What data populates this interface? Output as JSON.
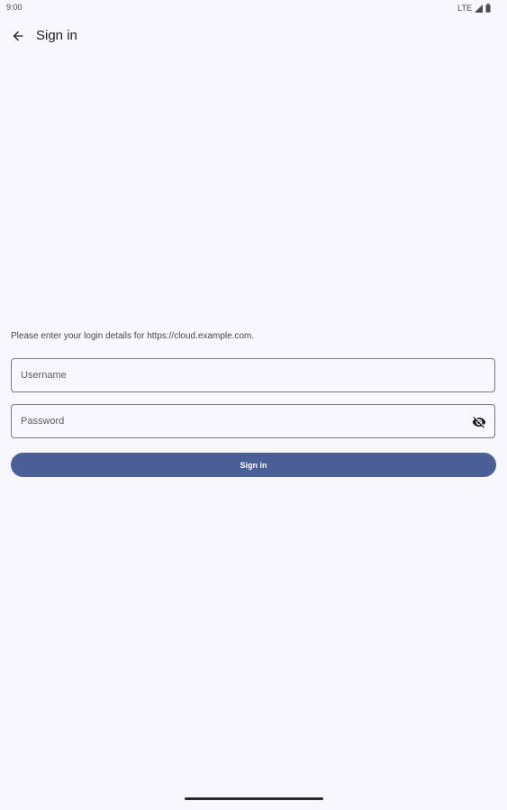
{
  "status_bar": {
    "time": "9:00",
    "network": "LTE",
    "signal_icon": "cell-signal-icon",
    "battery_icon": "battery-icon"
  },
  "app_bar": {
    "back_icon": "arrow-back-icon",
    "title": "Sign in"
  },
  "form": {
    "prompt": "Please enter your login details for https://cloud.example.com.",
    "username": {
      "placeholder": "Username",
      "value": ""
    },
    "password": {
      "placeholder": "Password",
      "value": "",
      "toggle_icon": "visibility-off-icon"
    },
    "submit_label": "Sign in"
  },
  "colors": {
    "background": "#f8f7fd",
    "primary": "#4a5f95",
    "outline": "#757780",
    "on_surface": "#1b1b21"
  }
}
